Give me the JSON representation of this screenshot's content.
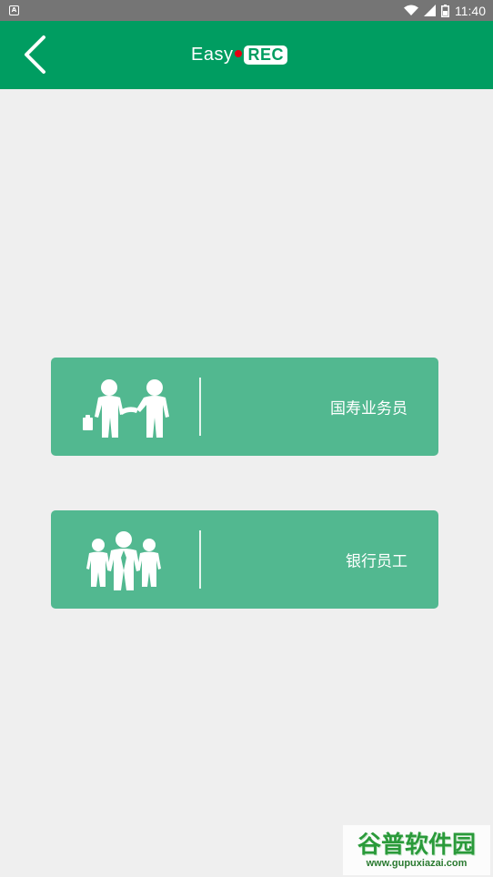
{
  "status_bar": {
    "app_badge": "A",
    "time": "11:40",
    "icons": [
      "wifi-icon",
      "cell-signal-icon",
      "battery-icon"
    ]
  },
  "app_bar": {
    "back_icon": "chevron-left-icon",
    "logo": {
      "easy": "Easy",
      "rec": "REC"
    }
  },
  "roles": [
    {
      "label": "国寿业务员",
      "icon": "agents-handshake-icon"
    },
    {
      "label": "银行员工",
      "icon": "staff-group-icon"
    }
  ],
  "watermark": {
    "logo": "谷普软件园",
    "url": "www.gupuxiazai.com"
  },
  "colors": {
    "app_bar": "#009d61",
    "card": "#52b890",
    "background": "#efefef",
    "status_bar": "#757575",
    "rec_dot": "#e60012"
  }
}
